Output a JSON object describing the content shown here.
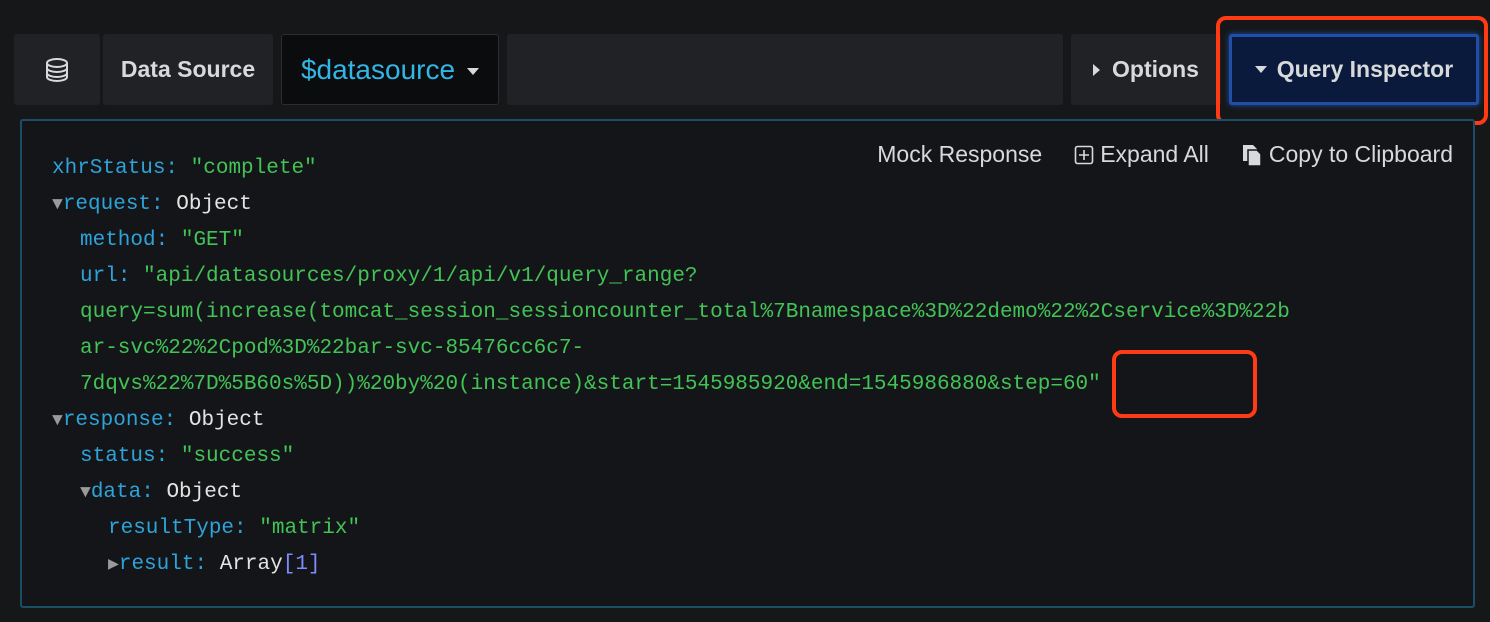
{
  "toolbar": {
    "data_source_label": "Data Source",
    "datasource_value": "$datasource",
    "options_label": "Options",
    "query_inspector_label": "Query Inspector"
  },
  "actions": {
    "mock_response": "Mock Response",
    "expand_all": "Expand All",
    "copy_to_clipboard": "Copy to Clipboard"
  },
  "tree": {
    "xhrStatus_key": "xhrStatus",
    "xhrStatus_value": "\"complete\"",
    "request_key": "request",
    "request_type": "Object",
    "method_key": "method",
    "method_value": "\"GET\"",
    "url_key": "url",
    "url_line1": "\"api/datasources/proxy/1/api/v1/query_range?",
    "url_line2": "query=sum(increase(tomcat_session_sessioncounter_total%7Bnamespace%3D%22demo%22%2Cservice%3D%22b",
    "url_line3": "ar-svc%22%2Cpod%3D%22bar-svc-85476cc6c7-",
    "url_line4": "7dqvs%22%7D%5B60s%5D))%20by%20(instance)&start=1545985920&end=1545986880&step=60\"",
    "response_key": "response",
    "response_type": "Object",
    "status_key": "status",
    "status_value": "\"success\"",
    "data_key": "data",
    "data_type": "Object",
    "resultType_key": "resultType",
    "resultType_value": "\"matrix\"",
    "result_key": "result",
    "result_type": "Array",
    "result_count": "1"
  },
  "colors": {
    "accent_blue": "#33b5e5",
    "key_blue": "#2ea3d9",
    "string_green": "#42c356",
    "highlight_red": "#ff3b16"
  },
  "icons": [
    "database-icon",
    "caret-down-icon",
    "caret-right-icon",
    "plus-square-icon",
    "clipboard-icon"
  ]
}
